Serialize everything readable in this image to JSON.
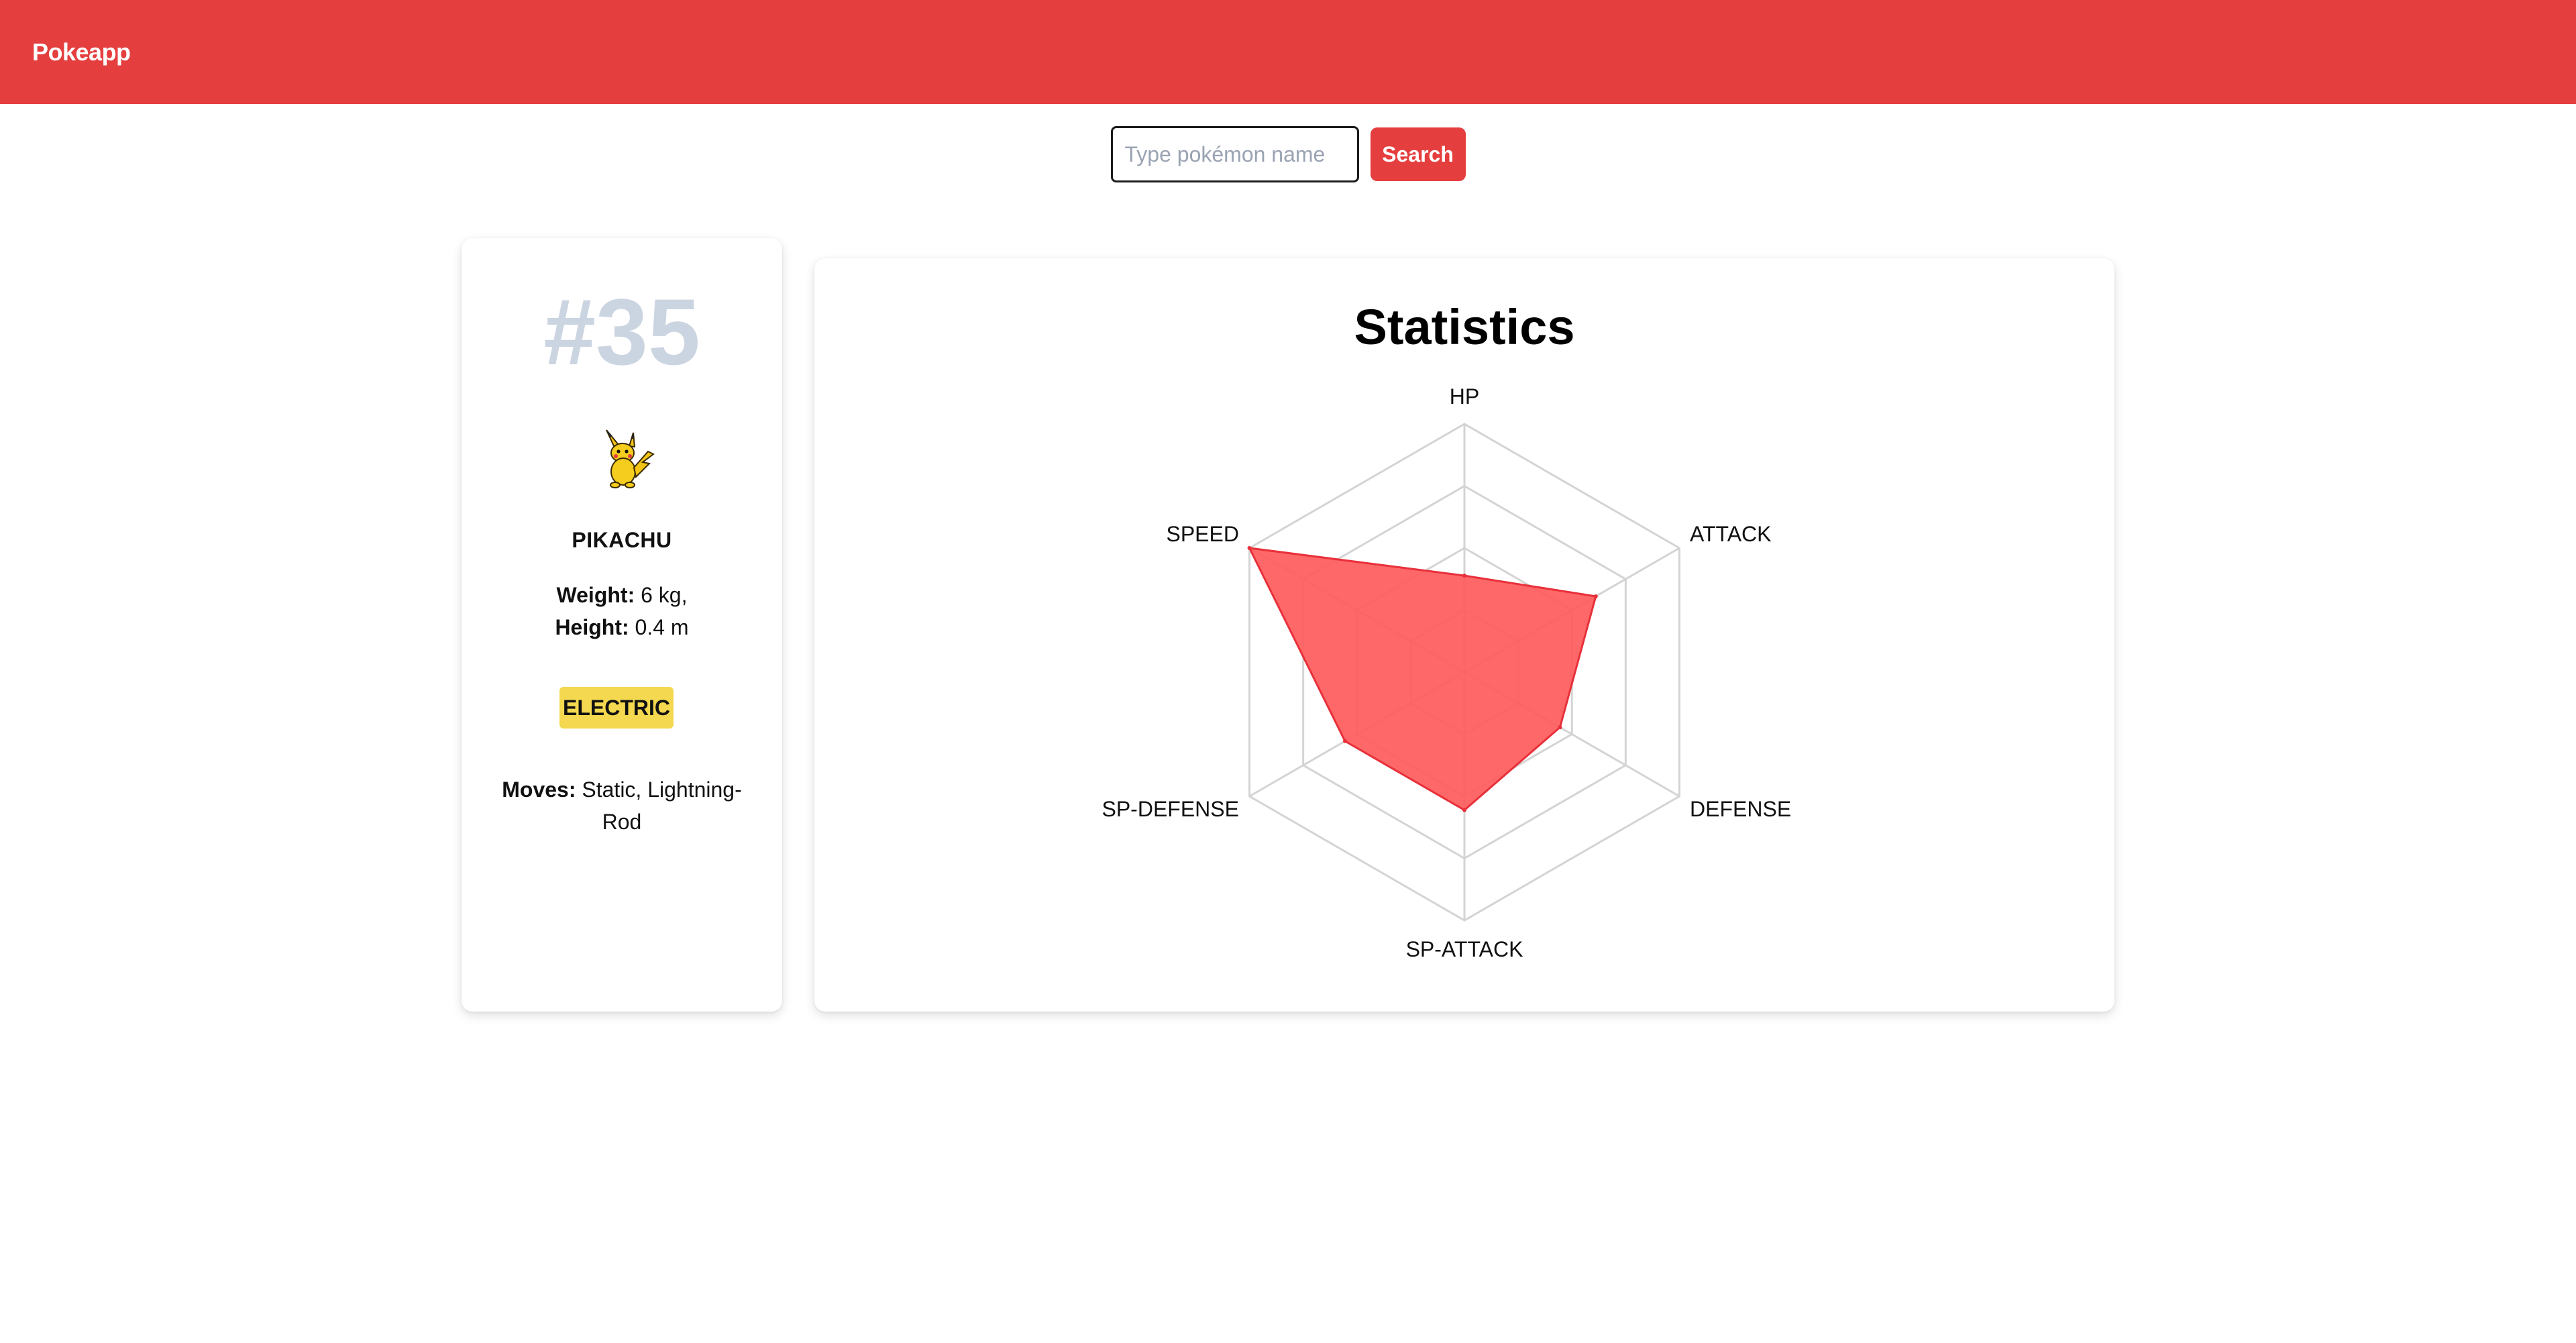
{
  "app": {
    "title": "Pokeapp"
  },
  "search": {
    "placeholder": "Type pokémon name",
    "button_label": "Search",
    "value": ""
  },
  "pokemon": {
    "id_label": "#35",
    "name": "PIKACHU",
    "weight_label": "Weight:",
    "weight_value": " 6 kg,",
    "height_label": "Height:",
    "height_value": " 0.4 m",
    "type": "ELECTRIC",
    "moves_label": "Moves:",
    "moves_value": " Static, Lightning-Rod"
  },
  "stats": {
    "title": "Statistics"
  },
  "colors": {
    "accent": "#e53e3e",
    "electric": "#f4d84f",
    "id_text": "#cbd5e1",
    "radar_fill": "#ff5c5c"
  },
  "chart_data": {
    "type": "radar",
    "categories": [
      "HP",
      "ATTACK",
      "DEFENSE",
      "SP-ATTACK",
      "SP-DEFENSE",
      "SPEED"
    ],
    "values": [
      35,
      55,
      40,
      50,
      50,
      90
    ],
    "range": [
      0,
      90
    ],
    "rings": 4,
    "grid": true
  }
}
